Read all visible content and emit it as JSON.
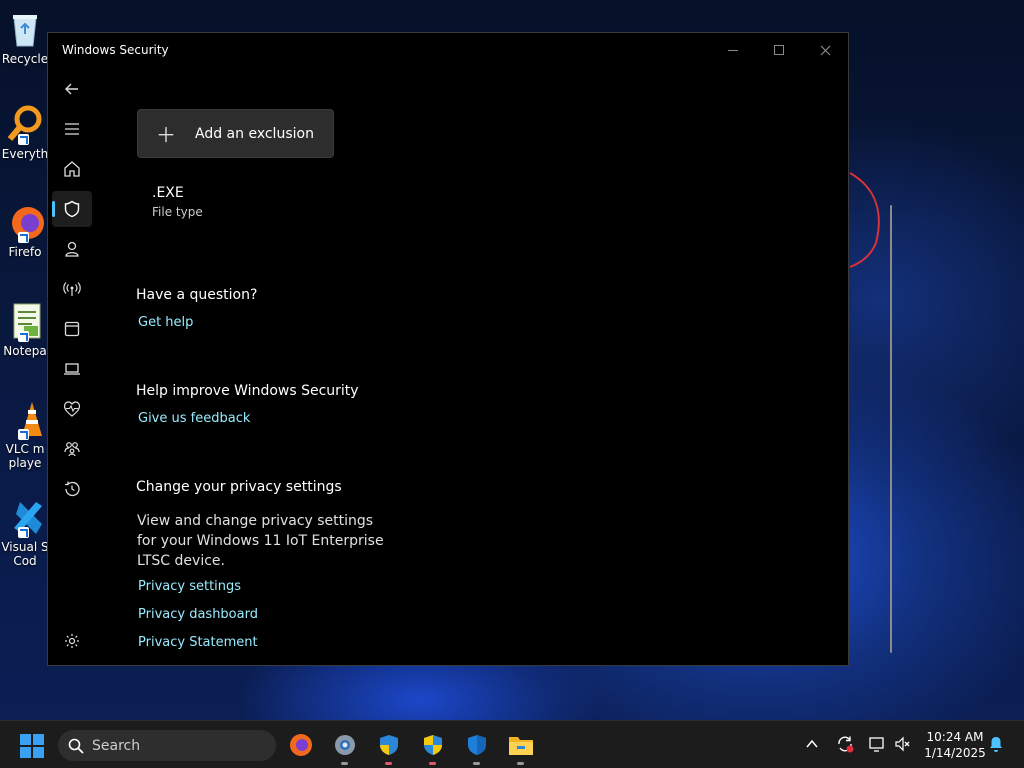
{
  "window": {
    "title": "Windows Security",
    "controls": {
      "minimize": "minimize",
      "maximize": "maximize",
      "close": "close"
    }
  },
  "desktop_icons": [
    {
      "label": "Recycle",
      "icon": "recycle-bin-icon"
    },
    {
      "label": "Everyth",
      "icon": "everything-search-icon"
    },
    {
      "label": "Firefo",
      "icon": "firefox-icon"
    },
    {
      "label": "Notepa",
      "icon": "notepad-icon"
    },
    {
      "label": "VLC m\nplaye",
      "icon": "vlc-icon"
    },
    {
      "label": "Visual S\nCod",
      "icon": "vscode-icon"
    }
  ],
  "nav": {
    "items": [
      {
        "icon": "back-arrow-icon"
      },
      {
        "icon": "hamburger-menu-icon"
      },
      {
        "icon": "home-icon"
      },
      {
        "icon": "shield-icon",
        "active": true
      },
      {
        "icon": "account-icon"
      },
      {
        "icon": "network-icon"
      },
      {
        "icon": "app-browser-icon"
      },
      {
        "icon": "device-security-icon"
      },
      {
        "icon": "health-icon"
      },
      {
        "icon": "family-icon"
      },
      {
        "icon": "history-icon"
      },
      {
        "icon": "settings-gear-icon"
      }
    ]
  },
  "content": {
    "add_button_label": "Add an exclusion",
    "exclusion": {
      "name": ".EXE",
      "type": "File type"
    },
    "question": {
      "title": "Have a question?",
      "link": "Get help"
    },
    "improve": {
      "title": "Help improve Windows Security",
      "link": "Give us feedback"
    },
    "privacy": {
      "title": "Change your privacy settings",
      "description": "View and change privacy settings for your Windows 11 IoT Enterprise LTSC device.",
      "links": [
        "Privacy settings",
        "Privacy dashboard",
        "Privacy Statement"
      ]
    }
  },
  "taskbar": {
    "search_placeholder": "Search",
    "time": "10:24 AM",
    "date": "1/14/2025",
    "apps": [
      "firefox-icon",
      "settings-app-icon",
      "windows-security-icon",
      "uac-shield-icon",
      "defender-shield-icon",
      "file-explorer-icon"
    ]
  },
  "colors": {
    "accent": "#4cc2ff",
    "link": "#99ebff",
    "window_bg": "#000000",
    "taskbar_bg": "#1c1c1c"
  }
}
